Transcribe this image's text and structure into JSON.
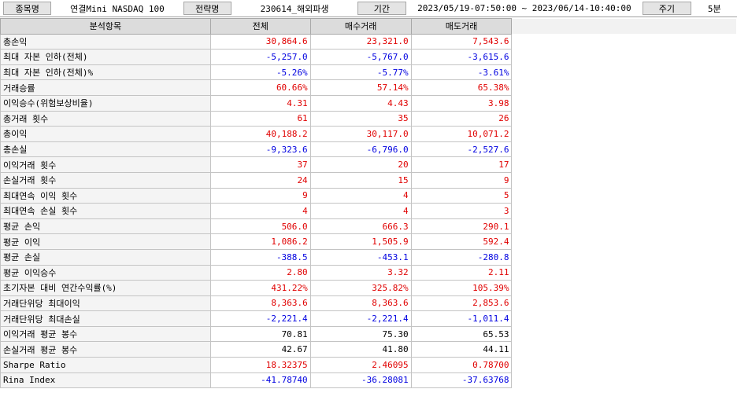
{
  "header": {
    "symbol_label": "종목명",
    "symbol_value": "연결Mini NASDAQ 100",
    "strategy_label": "전략명",
    "strategy_value": "230614_해외파생",
    "period_label": "기간",
    "period_value": "2023/05/19-07:50:00 ~ 2023/06/14-10:40:00",
    "cycle_label": "주기",
    "cycle_value": "5분"
  },
  "table": {
    "columns": [
      "분석항목",
      "전체",
      "매수거래",
      "매도거래"
    ],
    "rows": [
      {
        "label": "총손익",
        "values": [
          "30,864.6",
          "23,321.0",
          "7,543.6"
        ],
        "colors": [
          "pos",
          "pos",
          "pos"
        ]
      },
      {
        "label": "최대 자본 인하(전체)",
        "values": [
          "-5,257.0",
          "-5,767.0",
          "-3,615.6"
        ],
        "colors": [
          "neg",
          "neg",
          "neg"
        ]
      },
      {
        "label": "최대 자본 인하(전체)%",
        "values": [
          "-5.26%",
          "-5.77%",
          "-3.61%"
        ],
        "colors": [
          "neg",
          "neg",
          "neg"
        ]
      },
      {
        "label": "거래승률",
        "values": [
          "60.66%",
          "57.14%",
          "65.38%"
        ],
        "colors": [
          "pos",
          "pos",
          "pos"
        ]
      },
      {
        "label": "이익승수(위험보상비율)",
        "values": [
          "4.31",
          "4.43",
          "3.98"
        ],
        "colors": [
          "pos",
          "pos",
          "pos"
        ]
      },
      {
        "label": "총거래 횟수",
        "values": [
          "61",
          "35",
          "26"
        ],
        "colors": [
          "pos",
          "pos",
          "pos"
        ]
      },
      {
        "label": "총이익",
        "values": [
          "40,188.2",
          "30,117.0",
          "10,071.2"
        ],
        "colors": [
          "pos",
          "pos",
          "pos"
        ]
      },
      {
        "label": "총손실",
        "values": [
          "-9,323.6",
          "-6,796.0",
          "-2,527.6"
        ],
        "colors": [
          "neg",
          "neg",
          "neg"
        ]
      },
      {
        "label": "이익거래 횟수",
        "values": [
          "37",
          "20",
          "17"
        ],
        "colors": [
          "pos",
          "pos",
          "pos"
        ]
      },
      {
        "label": "손실거래 횟수",
        "values": [
          "24",
          "15",
          "9"
        ],
        "colors": [
          "pos",
          "pos",
          "pos"
        ]
      },
      {
        "label": "최대연속 이익 횟수",
        "values": [
          "9",
          "4",
          "5"
        ],
        "colors": [
          "pos",
          "pos",
          "pos"
        ]
      },
      {
        "label": "최대연속 손실 횟수",
        "values": [
          "4",
          "4",
          "3"
        ],
        "colors": [
          "pos",
          "pos",
          "pos"
        ]
      },
      {
        "label": "평균 손익",
        "values": [
          "506.0",
          "666.3",
          "290.1"
        ],
        "colors": [
          "pos",
          "pos",
          "pos"
        ]
      },
      {
        "label": "평균 이익",
        "values": [
          "1,086.2",
          "1,505.9",
          "592.4"
        ],
        "colors": [
          "pos",
          "pos",
          "pos"
        ]
      },
      {
        "label": "평균 손실",
        "values": [
          "-388.5",
          "-453.1",
          "-280.8"
        ],
        "colors": [
          "neg",
          "neg",
          "neg"
        ]
      },
      {
        "label": "평균 이익승수",
        "values": [
          "2.80",
          "3.32",
          "2.11"
        ],
        "colors": [
          "pos",
          "pos",
          "pos"
        ]
      },
      {
        "label": "초기자본 대비 연간수익률(%)",
        "values": [
          "431.22%",
          "325.82%",
          "105.39%"
        ],
        "colors": [
          "pos",
          "pos",
          "pos"
        ]
      },
      {
        "label": "거래단위당 최대이익",
        "values": [
          "8,363.6",
          "8,363.6",
          "2,853.6"
        ],
        "colors": [
          "pos",
          "pos",
          "pos"
        ]
      },
      {
        "label": "거래단위당 최대손실",
        "values": [
          "-2,221.4",
          "-2,221.4",
          "-1,011.4"
        ],
        "colors": [
          "neg",
          "neg",
          "neg"
        ]
      },
      {
        "label": "이익거래 평균 봉수",
        "values": [
          "70.81",
          "75.30",
          "65.53"
        ],
        "colors": [
          "neu",
          "neu",
          "neu"
        ]
      },
      {
        "label": "손실거래 평균 봉수",
        "values": [
          "42.67",
          "41.80",
          "44.11"
        ],
        "colors": [
          "neu",
          "neu",
          "neu"
        ]
      },
      {
        "label": "Sharpe Ratio",
        "values": [
          "18.32375",
          "2.46095",
          "0.78700"
        ],
        "colors": [
          "pos",
          "pos",
          "pos"
        ]
      },
      {
        "label": "Rina Index",
        "values": [
          "-41.78740",
          "-36.28081",
          "-37.63768"
        ],
        "colors": [
          "neg",
          "neg",
          "neg"
        ]
      }
    ]
  }
}
